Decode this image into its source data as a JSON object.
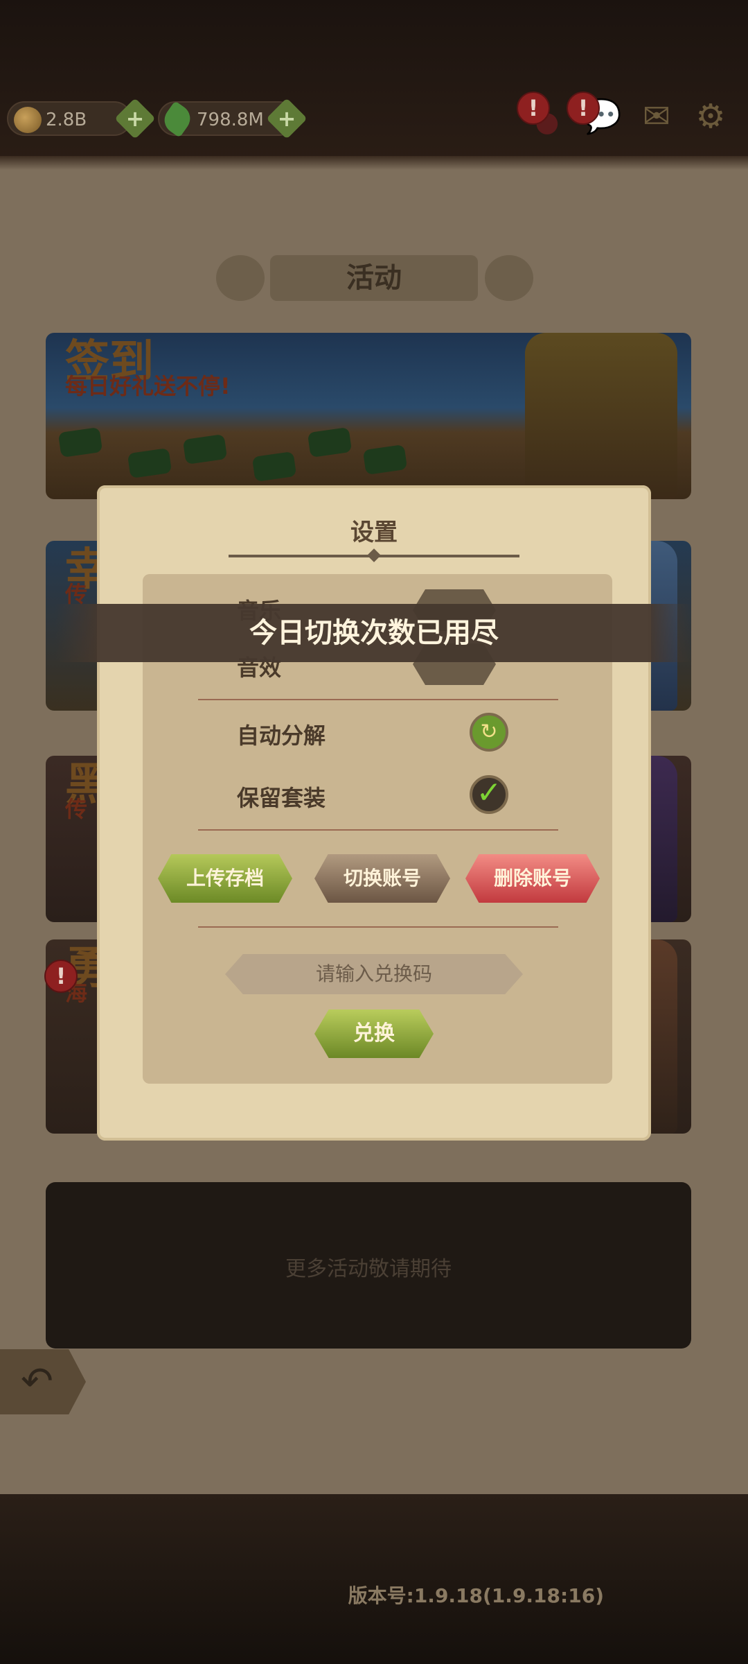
{
  "header": {
    "gold_amount": "2.8B",
    "gem_amount": "798.8M",
    "plus_label": "+",
    "badge_label": "!"
  },
  "activities": {
    "title": "活动",
    "cards": [
      {
        "title": "签到",
        "subtitle": "每日好礼送不停!"
      },
      {
        "title": "幸",
        "subtitle": "传"
      },
      {
        "title": "黑",
        "subtitle": "传"
      },
      {
        "title": "勇",
        "subtitle": "海"
      }
    ],
    "more_text": "更多活动敬请期待"
  },
  "settings": {
    "title": "设置",
    "rows": {
      "music": "音乐",
      "sfx": "音效",
      "auto_decompose": "自动分解",
      "keep_sets": "保留套装"
    },
    "buttons": {
      "upload": "上传存档",
      "switch": "切换账号",
      "delete": "删除账号"
    },
    "redeem": {
      "placeholder": "请输入兑换码",
      "button": "兑换"
    },
    "version": "版本号:1.9.18(1.9.18:16)"
  },
  "toast": {
    "message": "今日切换次数已用尽"
  },
  "icons": {
    "back_arrow": "↶",
    "mail": "✉",
    "gear": "⚙",
    "chat": "💬",
    "refresh": "↻",
    "check": "✓"
  },
  "colors": {
    "accent_green": "#6c8a26",
    "accent_red": "#c23a3f",
    "parchment": "#e4d4ae"
  }
}
